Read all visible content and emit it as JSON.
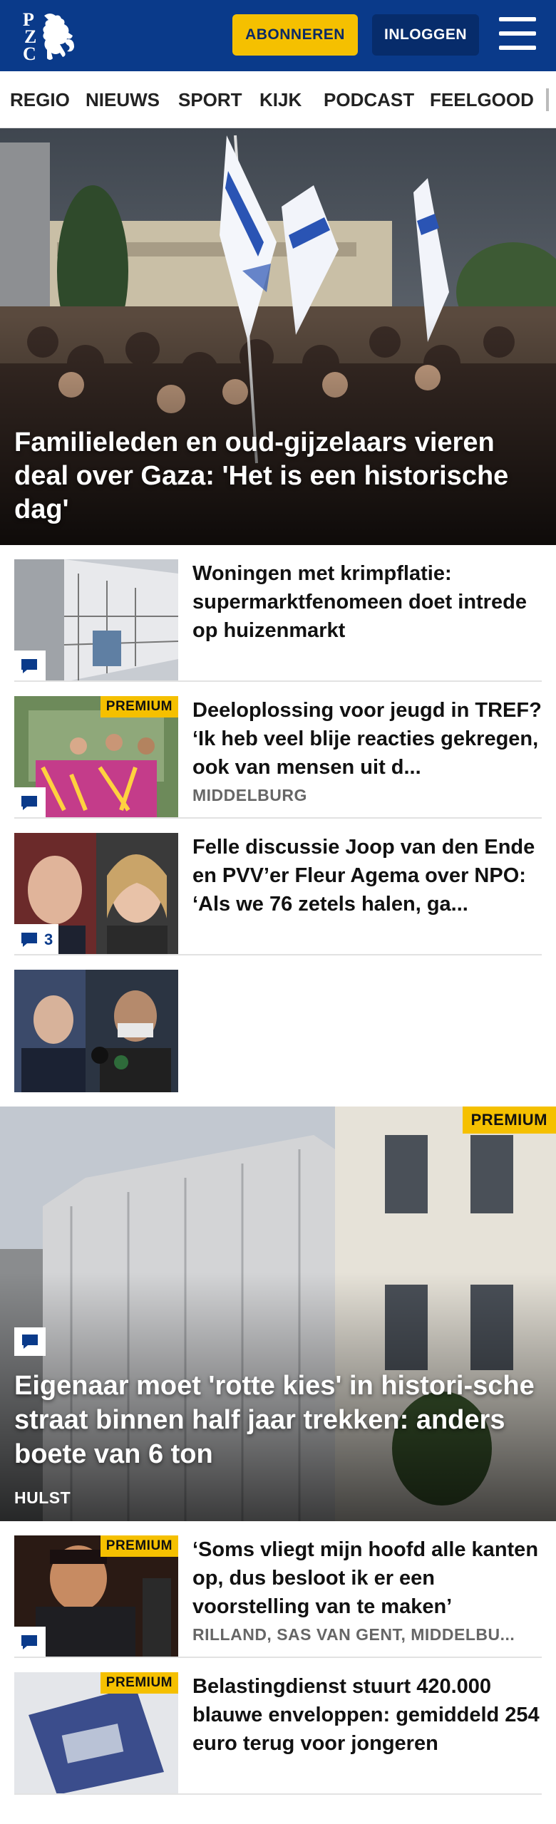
{
  "header": {
    "logo_letters": [
      "P",
      "Z",
      "C"
    ],
    "subscribe_label": "ABONNEREN",
    "login_label": "INLOGGEN",
    "menu_icon": "hamburger-icon",
    "brand_color": "#0a3a8a",
    "accent_color": "#f5c000"
  },
  "nav": {
    "items": [
      "REGIO",
      "NIEUWS",
      "SPORT",
      "KIJK",
      "PODCAST",
      "FEELGOOD"
    ]
  },
  "hero": {
    "title": "Familieleden en oud-gijzelaars vieren deal over Gaza: 'Het is een historische dag'"
  },
  "articles": [
    {
      "title": "Woningen met krimpflatie: supermarktfenomeen doet intrede op huizenmarkt",
      "premium": "",
      "location": "",
      "comments": ""
    },
    {
      "title": "Deeloplossing voor jeugd in TREF? ‘Ik heb veel blije reacties gekregen, ook van mensen uit d...",
      "premium": "PREMIUM",
      "location": "MIDDELBURG",
      "comments": ""
    },
    {
      "title": "Felle discussie Joop van den Ende en PVV’er Fleur Agema over NPO: ‘Als we 76 zetels halen, ga...",
      "premium": "",
      "location": "",
      "comments": "3"
    },
    {
      "title": "",
      "premium": "",
      "location": "",
      "comments": ""
    }
  ],
  "feature": {
    "premium": "PREMIUM",
    "title": "Eigenaar moet 'rotte kies' in histori-sche straat binnen half jaar trekken: anders boete van 6 ton",
    "location": "HULST"
  },
  "articles2": [
    {
      "title": "‘Soms vliegt mijn hoofd alle kanten op, dus besloot ik er een voorstelling van te maken’",
      "premium": "PREMIUM",
      "location": "RILLAND, SAS VAN GENT, MIDDELBU..."
    },
    {
      "title": "Belastingdienst stuurt 420.000 blauwe enveloppen: gemiddeld 254 euro terug voor jongeren",
      "premium": "PREMIUM",
      "location": ""
    }
  ]
}
